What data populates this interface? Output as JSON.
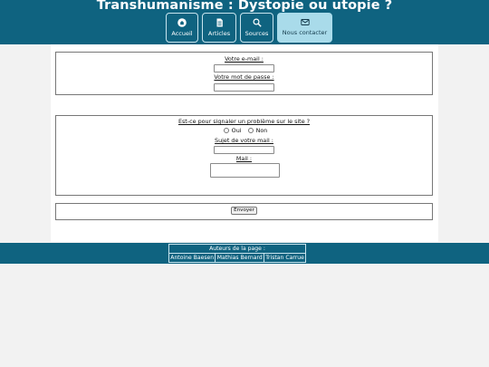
{
  "header": {
    "title": "Transhumanisme : Dystopie ou utopie ?",
    "nav": [
      {
        "label": "Accueil",
        "icon": "home-icon"
      },
      {
        "label": "Articles",
        "icon": "document-icon"
      },
      {
        "label": "Sources",
        "icon": "search-icon"
      },
      {
        "label": "Nous contacter",
        "icon": "mail-icon",
        "active": true
      }
    ]
  },
  "login_form": {
    "email_label": "Votre e-mail :",
    "password_label": "Votre mot de passe :",
    "email_value": "",
    "password_value": ""
  },
  "report_form": {
    "question": "Est-ce pour signaler un problème sur le site ?",
    "option_yes": "Oui",
    "option_no": "Non",
    "subject_label": "Sujet de votre mail :",
    "mail_label": "Mail :",
    "subject_value": "",
    "mail_value": ""
  },
  "submit": {
    "label": "Envoyer"
  },
  "footer": {
    "authors_title": "Auteurs de la page :",
    "authors": [
      "Antoine Baesen",
      "Mathias Bernard",
      "Tristan Carrue"
    ]
  },
  "colors": {
    "header_bg": "#0f6380",
    "active_tab_bg": "#a9dbea",
    "page_bg": "#f2f2f2"
  }
}
